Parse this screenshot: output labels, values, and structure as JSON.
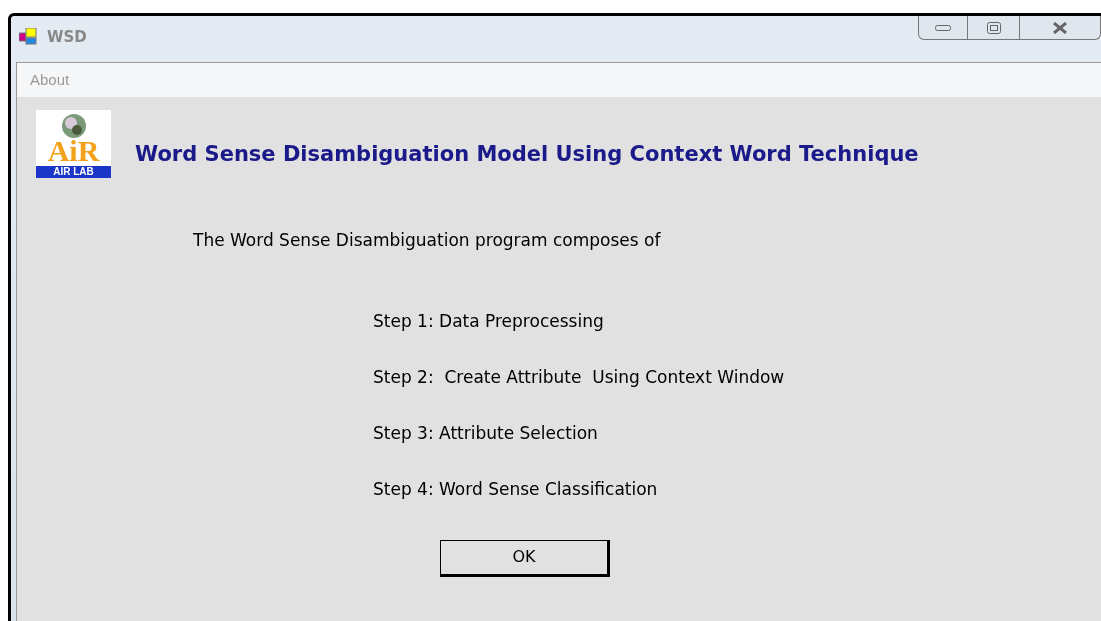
{
  "window": {
    "title": "WSD"
  },
  "menu": [
    "About"
  ],
  "logo": {
    "big": "AiR",
    "small": "AIR LAB"
  },
  "heading": "Word Sense Disambiguation Model Using Context Word Technique",
  "intro": "The Word Sense Disambiguation program composes of",
  "steps": [
    "Step 1: Data Preprocessing",
    "Step 2:  Create Attribute  Using Context Window",
    "Step 3: Attribute Selection",
    "Step 4: Word Sense Classification"
  ],
  "buttons": [
    "OK"
  ]
}
